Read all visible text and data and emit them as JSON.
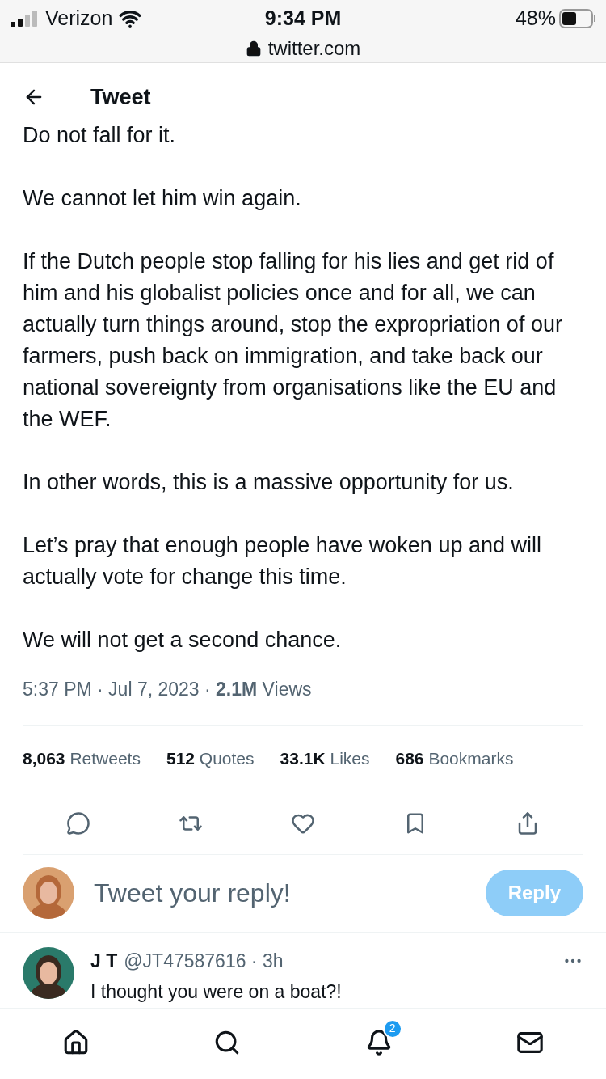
{
  "status_bar": {
    "carrier": "Verizon",
    "time": "9:34 PM",
    "battery": "48%"
  },
  "address_bar": {
    "url": "twitter.com"
  },
  "header": {
    "title": "Tweet"
  },
  "tweet": {
    "paragraphs": [
      "Do not fall for it.",
      "We cannot let him win again.",
      "If the Dutch people stop falling for his lies and get rid of him and his globalist policies once and for all, we can actually turn things around, stop the expropriation of our farmers, push back on immigration, and take back our national sovereignty from organisations like the EU and the WEF.",
      "In other words, this is a massive opportunity for us.",
      "Let’s pray that enough people have woken up and will actually vote for change this time.",
      "We will not get a second chance."
    ],
    "meta": "5:37 PM · Jul 7, 2023 · **2.1M** Views",
    "stats": [
      {
        "count": "8,063",
        "label": "Retweets"
      },
      {
        "count": "512",
        "label": "Quotes"
      },
      {
        "count": "33.1K",
        "label": "Likes"
      },
      {
        "count": "686",
        "label": "Bookmarks"
      }
    ],
    "actions": [
      {
        "kind": "reply"
      },
      {
        "kind": "retweet"
      },
      {
        "kind": "like"
      },
      {
        "kind": "bookmark"
      },
      {
        "kind": "share"
      }
    ]
  },
  "composer": {
    "placeholder": "Tweet your reply!",
    "button": "Reply",
    "disabled": true
  },
  "replies": [
    {
      "name": "J T",
      "handle": "@JT47587616 · 3h",
      "text": "I thought you were on a boat?!"
    }
  ],
  "bottom_nav": [
    {
      "kind": "home"
    },
    {
      "kind": "search"
    },
    {
      "kind": "notifications",
      "badge": "2"
    },
    {
      "kind": "messages"
    }
  ]
}
